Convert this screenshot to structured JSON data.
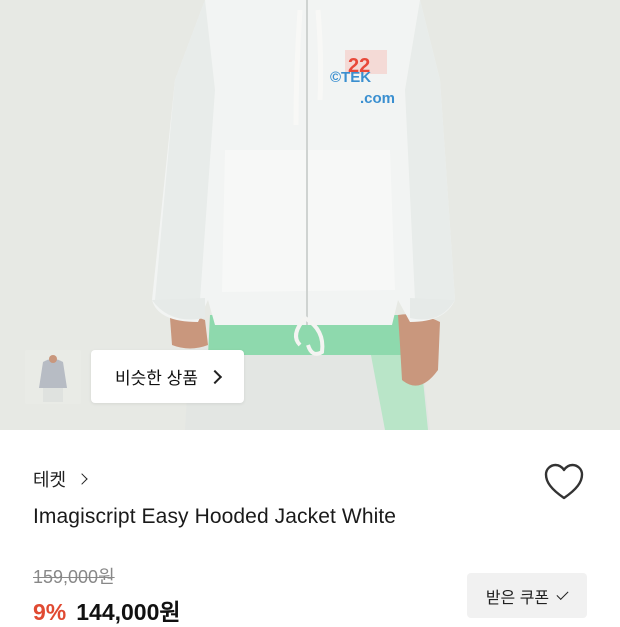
{
  "hero": {
    "image_alt": "Model wearing white hooded zip-up jacket",
    "print_text": "©TEKE .com",
    "similar_button": {
      "label": "비슷한 상품",
      "icon": "chevron-right-icon"
    }
  },
  "product": {
    "brand": "테켓",
    "title": "Imagiscript Easy Hooded Jacket White",
    "original_price": "159,000원",
    "discount": "9%",
    "price": "144,000원",
    "coupon_label": "받은 쿠폰",
    "wishlist_icon": "heart-outline-icon"
  },
  "colors": {
    "discount": "#e04a32",
    "hero_bg": "#e7e9e4",
    "coupon_bg": "#f1f1f1"
  }
}
